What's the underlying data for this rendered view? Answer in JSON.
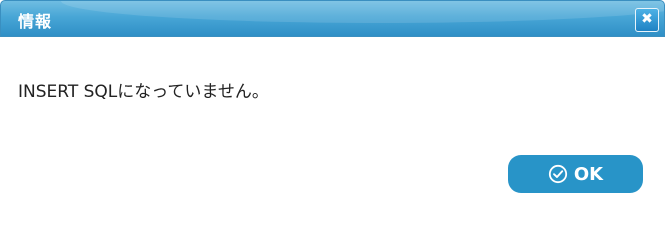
{
  "dialog": {
    "title": "情報",
    "close_icon": "close-icon",
    "message": "INSERT SQLになっていません。",
    "ok_label": "OK",
    "ok_icon": "check-circle-icon"
  },
  "colors": {
    "titlebar": "#48a6d6",
    "button": "#2894c8",
    "text": "#222222"
  }
}
